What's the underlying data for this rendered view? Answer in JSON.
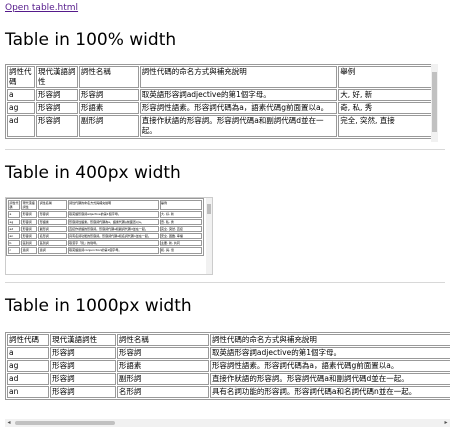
{
  "link_text": "Open table.html",
  "sections": [
    {
      "heading": "Table in 100% width"
    },
    {
      "heading": "Table in 400px width"
    },
    {
      "heading": "Table in 1000px width"
    }
  ],
  "table": {
    "headers": [
      "詞性代碼",
      "現代漢語詞性",
      "詞性名稱",
      "詞性代碼的命名方式與補充說明",
      "舉例"
    ],
    "rows": [
      [
        "a",
        "形容詞",
        "形容詞",
        "取英語形容詞adjective的第1個字母。",
        "大, 好, 新"
      ],
      [
        "ag",
        "形容詞",
        "形語素",
        "形容詞性語素。形容詞代碼為a，語素代碼g前面置以a。",
        "奇, 私, 秀"
      ],
      [
        "ad",
        "形容詞",
        "副形詞",
        "直接作狀語的形容詞。形容詞代碼a和副詞代碼d並在一起。",
        "完全, 突然, 直接"
      ],
      [
        "an",
        "形容詞",
        "名形詞",
        "具有名詞功能的形容詞。形容詞代碼a和名詞代碼n並在一起。",
        "安全, 困難, 幸福"
      ],
      [
        "b",
        "區別詞",
        "區別詞",
        "取漢字「別」的聲母。",
        "主要, 新, 共同"
      ],
      [
        "c",
        "連詞",
        "連詞",
        "取英語連詞conjunction的第1個字母。",
        "和, 與, 但"
      ]
    ]
  },
  "scroll_arrows": {
    "left": "◂",
    "right": "▸"
  }
}
